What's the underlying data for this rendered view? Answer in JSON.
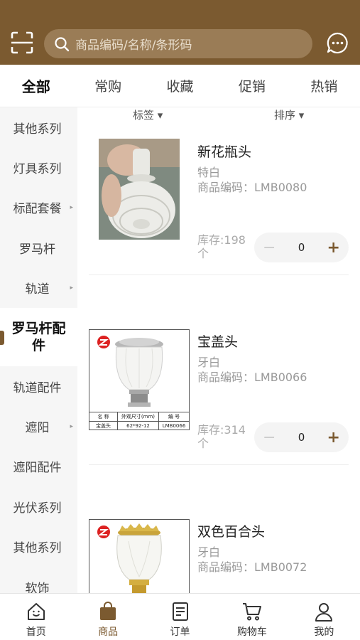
{
  "header": {
    "search_placeholder": "商品编码/名称/条形码"
  },
  "tabs": [
    {
      "label": "全部",
      "active": true
    },
    {
      "label": "常购"
    },
    {
      "label": "收藏"
    },
    {
      "label": "促销"
    },
    {
      "label": "热销"
    }
  ],
  "sidebar": {
    "items": [
      {
        "label": "其他系列"
      },
      {
        "label": "灯具系列"
      },
      {
        "label": "标配套餐",
        "has_arrow": true
      },
      {
        "label": "罗马杆"
      },
      {
        "label": "轨道",
        "has_arrow": true
      },
      {
        "label": "罗马杆配件",
        "active": true
      },
      {
        "label": "轨道配件"
      },
      {
        "label": "遮阳",
        "has_arrow": true
      },
      {
        "label": "遮阳配件"
      },
      {
        "label": "光伏系列"
      },
      {
        "label": "其他系列"
      },
      {
        "label": "软饰"
      }
    ]
  },
  "filter": {
    "tag_label": "标签 ▾",
    "sort_label": "排序 ▾"
  },
  "products": [
    {
      "name": "新花瓶头",
      "color": "特白",
      "code": "商品编码：LMB0080",
      "stock": "库存:198个",
      "qty": "0"
    },
    {
      "name": "宝盖头",
      "color": "牙白",
      "code": "商品编码：LMB0066",
      "stock": "库存:314个",
      "qty": "0",
      "label_table": {
        "h1": "名 称",
        "h2": "外观尺寸(mm)",
        "h3": "编 号",
        "v1": "宝盖头",
        "v2": "62*92-12",
        "v3": "LMB0066"
      }
    },
    {
      "name": "双色百合头",
      "color": "牙白",
      "code": "商品编码：LMB0072"
    }
  ],
  "stepper": {
    "minus": "−",
    "plus": "+"
  },
  "bottom_nav": [
    {
      "label": "首页",
      "icon": "home-icon"
    },
    {
      "label": "商品",
      "icon": "bag-icon",
      "active": true
    },
    {
      "label": "订单",
      "icon": "order-icon"
    },
    {
      "label": "购物车",
      "icon": "cart-icon"
    },
    {
      "label": "我的",
      "icon": "user-icon"
    }
  ],
  "colors": {
    "brand": "#7b5a30",
    "search_bg": "#9a7c56"
  }
}
